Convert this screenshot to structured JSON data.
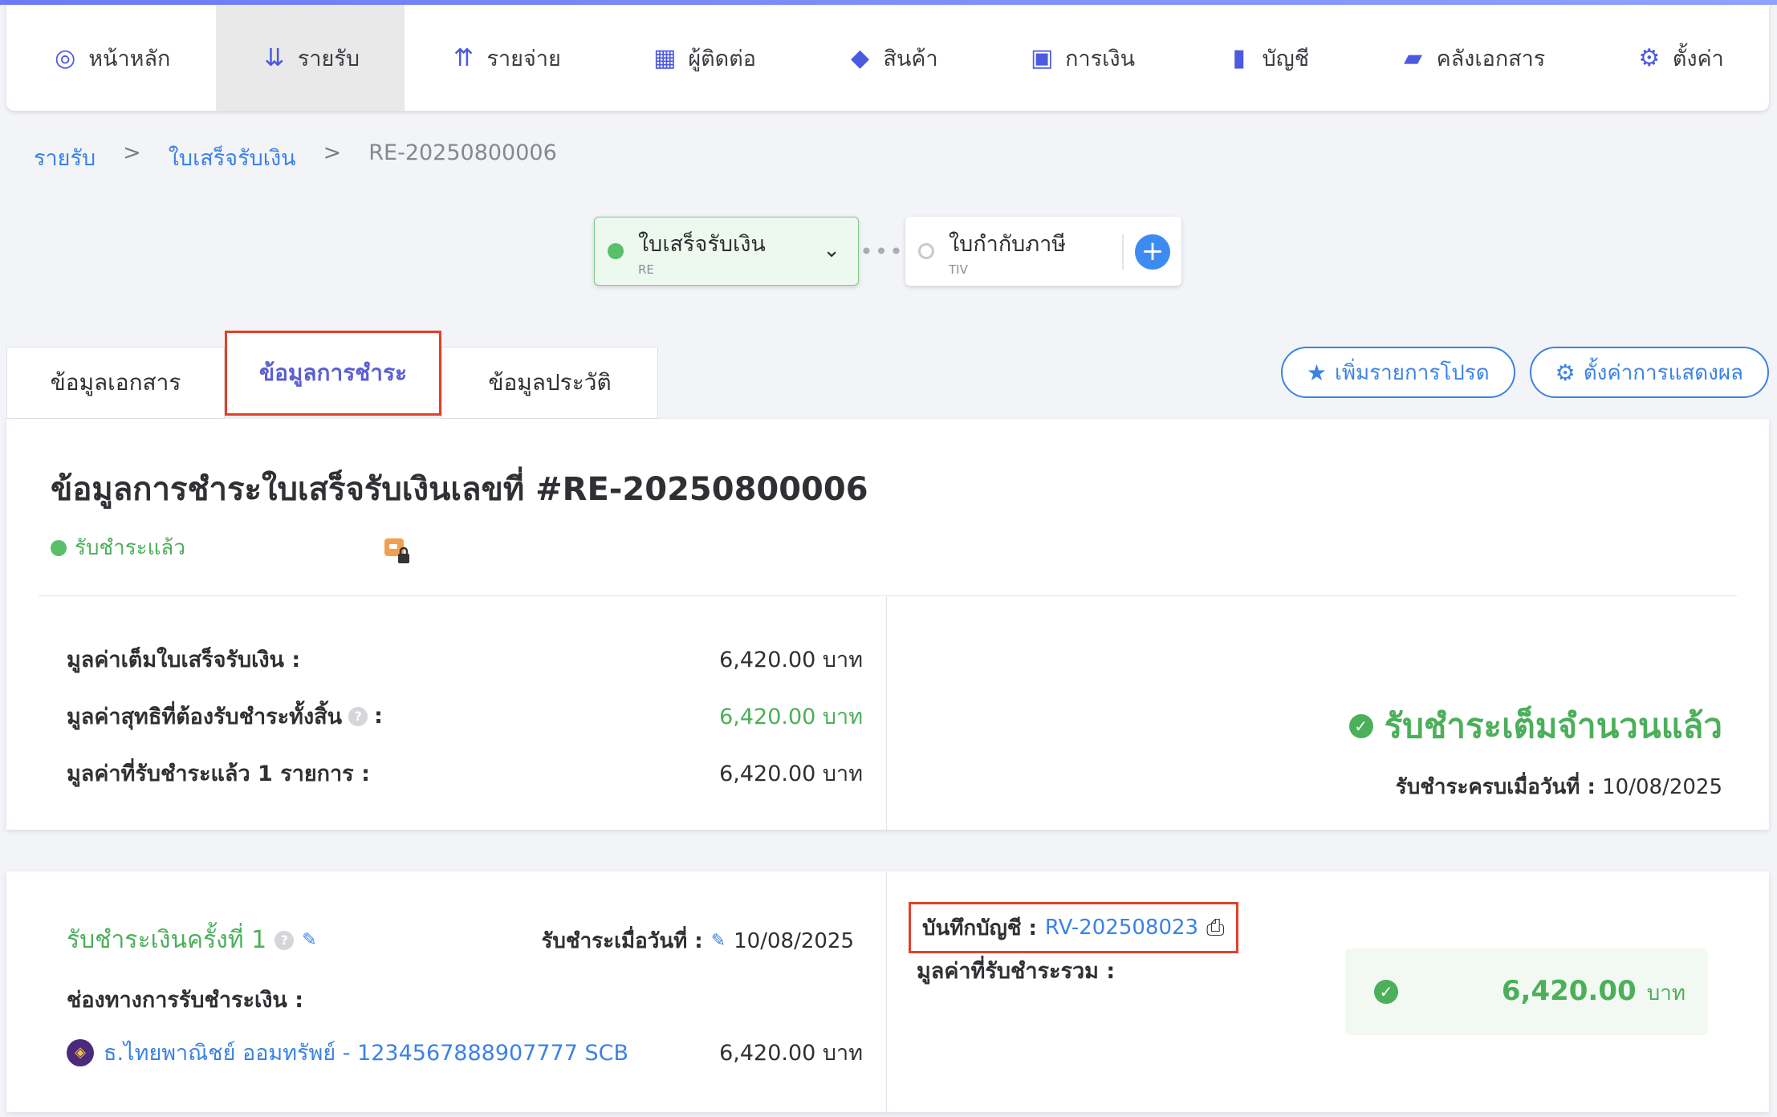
{
  "nav": [
    {
      "label": "หน้าหลัก",
      "icon": "dashboard-icon"
    },
    {
      "label": "รายรับ",
      "icon": "income-icon",
      "active": true
    },
    {
      "label": "รายจ่าย",
      "icon": "expense-icon"
    },
    {
      "label": "ผู้ติดต่อ",
      "icon": "contacts-icon"
    },
    {
      "label": "สินค้า",
      "icon": "product-box-icon"
    },
    {
      "label": "การเงิน",
      "icon": "money-icon"
    },
    {
      "label": "บัญชี",
      "icon": "ledger-icon"
    },
    {
      "label": "คลังเอกสาร",
      "icon": "folder-icon"
    },
    {
      "label": "ตั้งค่า",
      "icon": "gear-icon"
    }
  ],
  "breadcrumb": {
    "level1": "รายรับ",
    "sep": ">",
    "level2": "ใบเสร็จรับเงิน",
    "current": "RE-20250800006"
  },
  "flow": {
    "current": {
      "title": "ใบเสร็จรับเงิน",
      "code": "RE"
    },
    "next": {
      "title": "ใบกำกับภาษี",
      "code": "TIV"
    }
  },
  "tabs": [
    "ข้อมูลเอกสาร",
    "ข้อมูลการชำระ",
    "ข้อมูลประวัติ"
  ],
  "actions": {
    "favorite": "เพิ่มรายการโปรด",
    "display_settings": "ตั้งค่าการแสดงผล"
  },
  "summary": {
    "title": "ข้อมูลการชำระใบเสร็จรับเงินเลขที่ #RE-20250800006",
    "status": "รับชำระแล้ว",
    "rows": [
      {
        "label": "มูลค่าเต็มใบเสร็จรับเงิน :",
        "value": "6,420.00 บาท"
      },
      {
        "label": "มูลค่าสุทธิที่ต้องรับชำระทั้งสิ้น",
        "suffix": ":",
        "value": "6,420.00 บาท"
      },
      {
        "label": "มูลค่าที่รับชำระแล้ว 1 รายการ :",
        "value": "6,420.00 บาท"
      }
    ],
    "full_paid": "รับชำระเต็มจำนวนแล้ว",
    "paid_date_label": "รับชำระครบเมื่อวันที่ :",
    "paid_date": "10/08/2025"
  },
  "payment": {
    "title": "รับชำระเงินครั้งที่ 1",
    "date_label": "รับชำระเมื่อวันที่ :",
    "date": "10/08/2025",
    "channel_label": "ช่องทางการรับชำระเงิน :",
    "bank": "ธ.ไทยพาณิชย์ ออมทรัพย์ - 1234567888907777 SCB",
    "bank_amount": "6,420.00 บาท",
    "account_label": "บันทึกบัญชี :",
    "account_ref": "RV-202508023",
    "total_label": "มูลค่าที่รับชำระรวม :",
    "total_amount": "6,420.00",
    "total_unit": "บาท"
  },
  "colors": {
    "accent": "#3b82e6",
    "success": "#4caf5a",
    "highlight": "#e3402b",
    "nav_icon": "#4b5ae0"
  }
}
